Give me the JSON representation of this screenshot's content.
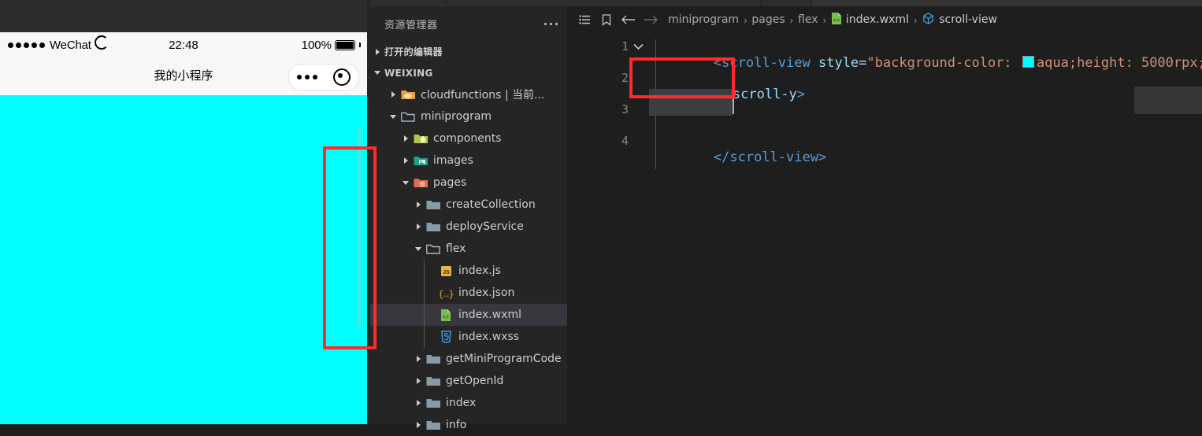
{
  "simulator": {
    "status_bar": {
      "carrier": "WeChat",
      "signal_dots": 5,
      "wifi_icon": "wifi-icon",
      "time": "22:48",
      "battery_percent": "100%",
      "battery_icon": "battery-full-icon"
    },
    "nav_bar": {
      "title": "我的小程序",
      "capsule": {
        "more_icon": "more-dots-icon",
        "target_icon": "target-circle-icon"
      }
    },
    "page": {
      "background_color": "#00ffff",
      "scrollbar_color": "#4fe6e6"
    }
  },
  "explorer": {
    "header": {
      "title": "资源管理器",
      "more_icon": "more-dots-icon"
    },
    "sections": [
      {
        "label": "打开的编辑器",
        "expanded": false
      },
      {
        "label": "WEIXING",
        "expanded": true
      }
    ],
    "tree": [
      {
        "label": "cloudfunctions | 当前...",
        "type": "folder",
        "icon": "folder-cloud-icon",
        "depth": 1,
        "expanded": false,
        "selected": false
      },
      {
        "label": "miniprogram",
        "type": "folder",
        "icon": "folder-open-icon",
        "depth": 1,
        "expanded": true,
        "selected": false
      },
      {
        "label": "components",
        "type": "folder",
        "icon": "folder-components-icon",
        "depth": 2,
        "expanded": false,
        "selected": false
      },
      {
        "label": "images",
        "type": "folder",
        "icon": "folder-images-icon",
        "depth": 2,
        "expanded": false,
        "selected": false
      },
      {
        "label": "pages",
        "type": "folder",
        "icon": "folder-pages-icon",
        "depth": 2,
        "expanded": true,
        "selected": false
      },
      {
        "label": "createCollection",
        "type": "folder",
        "icon": "folder-icon",
        "depth": 3,
        "expanded": false,
        "selected": false
      },
      {
        "label": "deployService",
        "type": "folder",
        "icon": "folder-icon",
        "depth": 3,
        "expanded": false,
        "selected": false
      },
      {
        "label": "flex",
        "type": "folder",
        "icon": "folder-open-icon",
        "depth": 3,
        "expanded": true,
        "selected": false
      },
      {
        "label": "index.js",
        "type": "file",
        "icon": "js-file-icon",
        "depth": 4,
        "expanded": null,
        "selected": false
      },
      {
        "label": "index.json",
        "type": "file",
        "icon": "json-file-icon",
        "depth": 4,
        "expanded": null,
        "selected": false
      },
      {
        "label": "index.wxml",
        "type": "file",
        "icon": "wxml-file-icon",
        "depth": 4,
        "expanded": null,
        "selected": true
      },
      {
        "label": "index.wxss",
        "type": "file",
        "icon": "wxss-file-icon",
        "depth": 4,
        "expanded": null,
        "selected": false
      },
      {
        "label": "getMiniProgramCode",
        "type": "folder",
        "icon": "folder-icon",
        "depth": 3,
        "expanded": false,
        "selected": false
      },
      {
        "label": "getOpenId",
        "type": "folder",
        "icon": "folder-icon",
        "depth": 3,
        "expanded": false,
        "selected": false
      },
      {
        "label": "index",
        "type": "folder",
        "icon": "folder-icon",
        "depth": 3,
        "expanded": false,
        "selected": false
      },
      {
        "label": "info",
        "type": "folder",
        "icon": "folder-icon",
        "depth": 3,
        "expanded": false,
        "selected": false
      }
    ]
  },
  "editor": {
    "toolbar_icons": [
      "list-icon",
      "bookmark-icon",
      "arrow-left-icon",
      "arrow-right-icon"
    ],
    "breadcrumb": [
      {
        "label": "miniprogram",
        "icon": null
      },
      {
        "label": "pages",
        "icon": null
      },
      {
        "label": "flex",
        "icon": null
      },
      {
        "label": "index.wxml",
        "icon": "wxml-file-icon"
      },
      {
        "label": "scroll-view",
        "icon": "symbol-cube-icon"
      }
    ],
    "breadcrumb_separator": "›",
    "line_numbers": [
      "1",
      "2",
      "3",
      "4"
    ],
    "code": {
      "line1": {
        "open_bracket": "<",
        "tag_name": "scroll-view",
        "attr": "style",
        "equals": "=",
        "quote_open": "\"",
        "value_prefix": "background-color: ",
        "color_swatch": "#00ffff",
        "value_color_name": "aqua;height: 5000rpx;",
        "quote_close": "\""
      },
      "line2": {
        "text": "scroll-y",
        "trailing": ">"
      },
      "line3": {
        "text": ""
      },
      "line4": {
        "text": "</scroll-view>"
      }
    },
    "fold_icon": "chevron-down-icon"
  },
  "annotations": [
    {
      "name": "simulator-scrollbar-highlight",
      "color": "#ff2a2a"
    },
    {
      "name": "scroll-y-attribute-highlight",
      "color": "#ff2a2a"
    }
  ]
}
